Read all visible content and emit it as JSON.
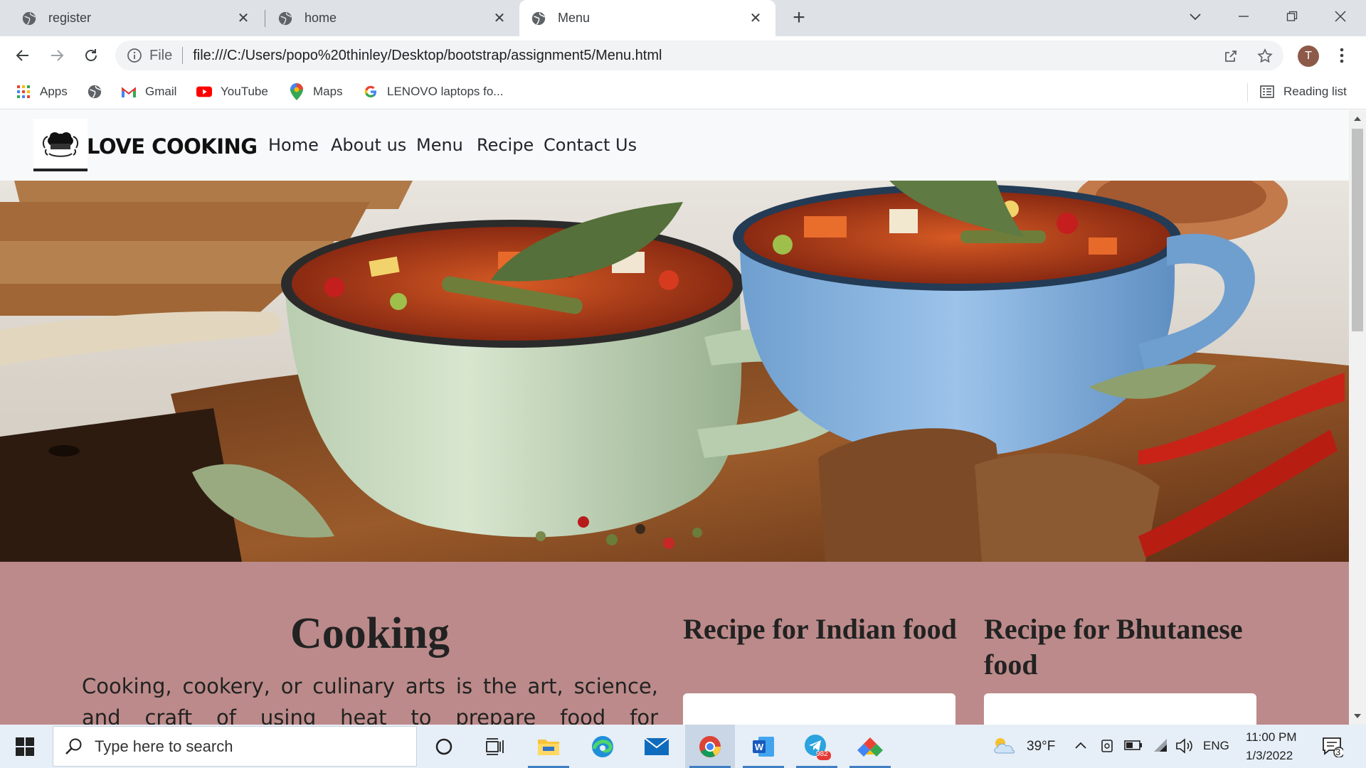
{
  "browser": {
    "tabs": [
      {
        "title": "register",
        "active": false
      },
      {
        "title": "home",
        "active": false
      },
      {
        "title": "Menu",
        "active": true
      }
    ],
    "address": {
      "scheme_label": "File",
      "url": "file:///C:/Users/popo%20thinley/Desktop/bootstrap/assignment5/Menu.html"
    },
    "profile_initial": "T",
    "bookmarks": [
      {
        "label": "Apps",
        "icon": "apps-grid-icon"
      },
      {
        "label": "",
        "icon": "globe-icon"
      },
      {
        "label": "Gmail",
        "icon": "gmail-icon"
      },
      {
        "label": "YouTube",
        "icon": "youtube-icon"
      },
      {
        "label": "Maps",
        "icon": "maps-icon"
      },
      {
        "label": "LENOVO laptops fo...",
        "icon": "google-icon"
      }
    ],
    "reading_list": "Reading list"
  },
  "site": {
    "brand": "LOVE COOKING",
    "nav": [
      "Home",
      "About us",
      "Menu",
      "Recipe",
      "Contact Us"
    ],
    "hero_alt": "soup bowls",
    "main": {
      "title": "Cooking",
      "text": "Cooking, cookery, or culinary arts is the art, science, and craft of using heat to prepare food for consumption. Cooking"
    },
    "recipes": [
      {
        "title": "Recipe for Indian food"
      },
      {
        "title": "Recipe for Bhutanese food"
      }
    ]
  },
  "taskbar": {
    "search_placeholder": "Type here to search",
    "telegram_badge": "982",
    "weather": "39°F",
    "language": "ENG",
    "time": "11:00 PM",
    "date": "1/3/2022",
    "notifications": "3"
  },
  "colors": {
    "content_bg": "#bc8a8a",
    "tabstrip": "#dee1e6",
    "taskbar": "#e6eef7"
  }
}
